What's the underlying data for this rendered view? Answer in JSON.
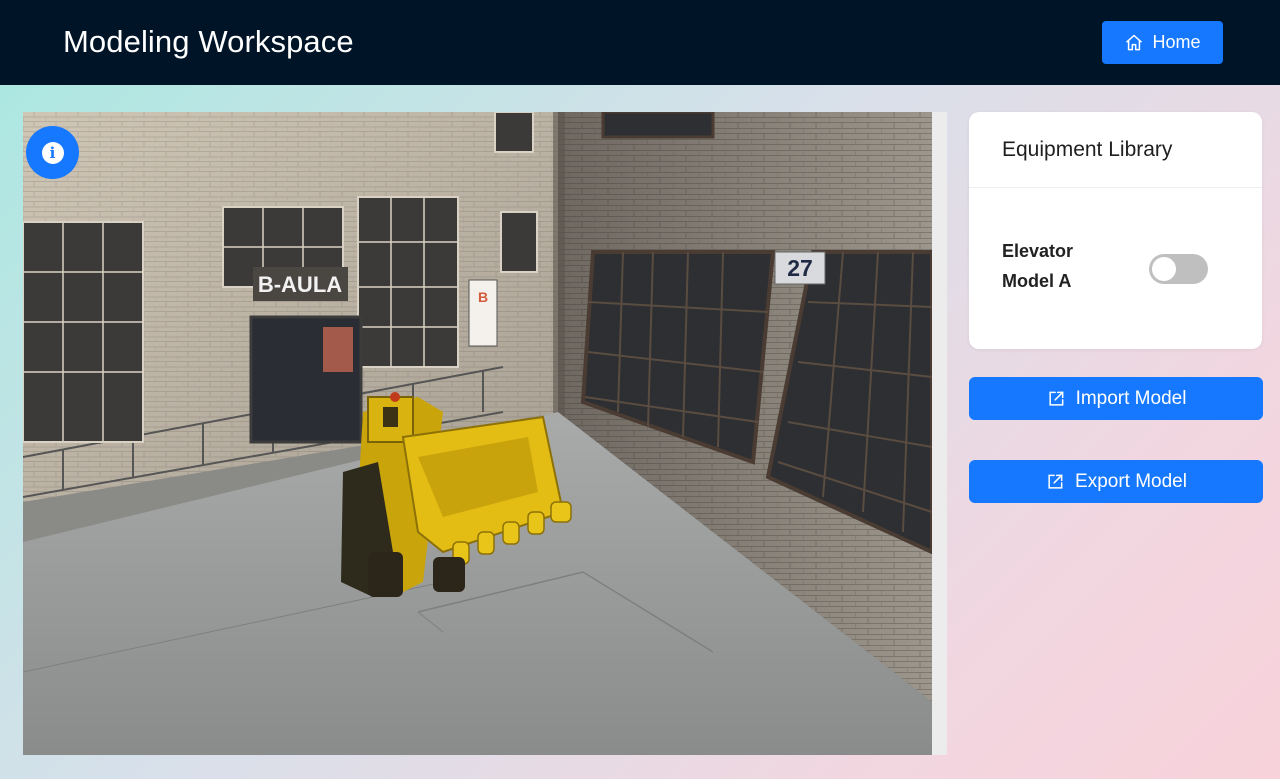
{
  "header": {
    "title": "Modeling Workspace",
    "home_label": "Home",
    "home_icon": "home-icon",
    "background": "#001428"
  },
  "viewport": {
    "building_sign": "B-AULA",
    "building_number": "27",
    "info_icon": "info-icon"
  },
  "library": {
    "title": "Equipment Library",
    "items": [
      {
        "label": "Elevator Model A",
        "enabled": false
      }
    ]
  },
  "actions": {
    "import_label": "Import Model",
    "export_label": "Export Model",
    "icon": "external-link-icon"
  },
  "colors": {
    "accent": "#1677ff",
    "toggle_off": "#bfbfbf"
  }
}
